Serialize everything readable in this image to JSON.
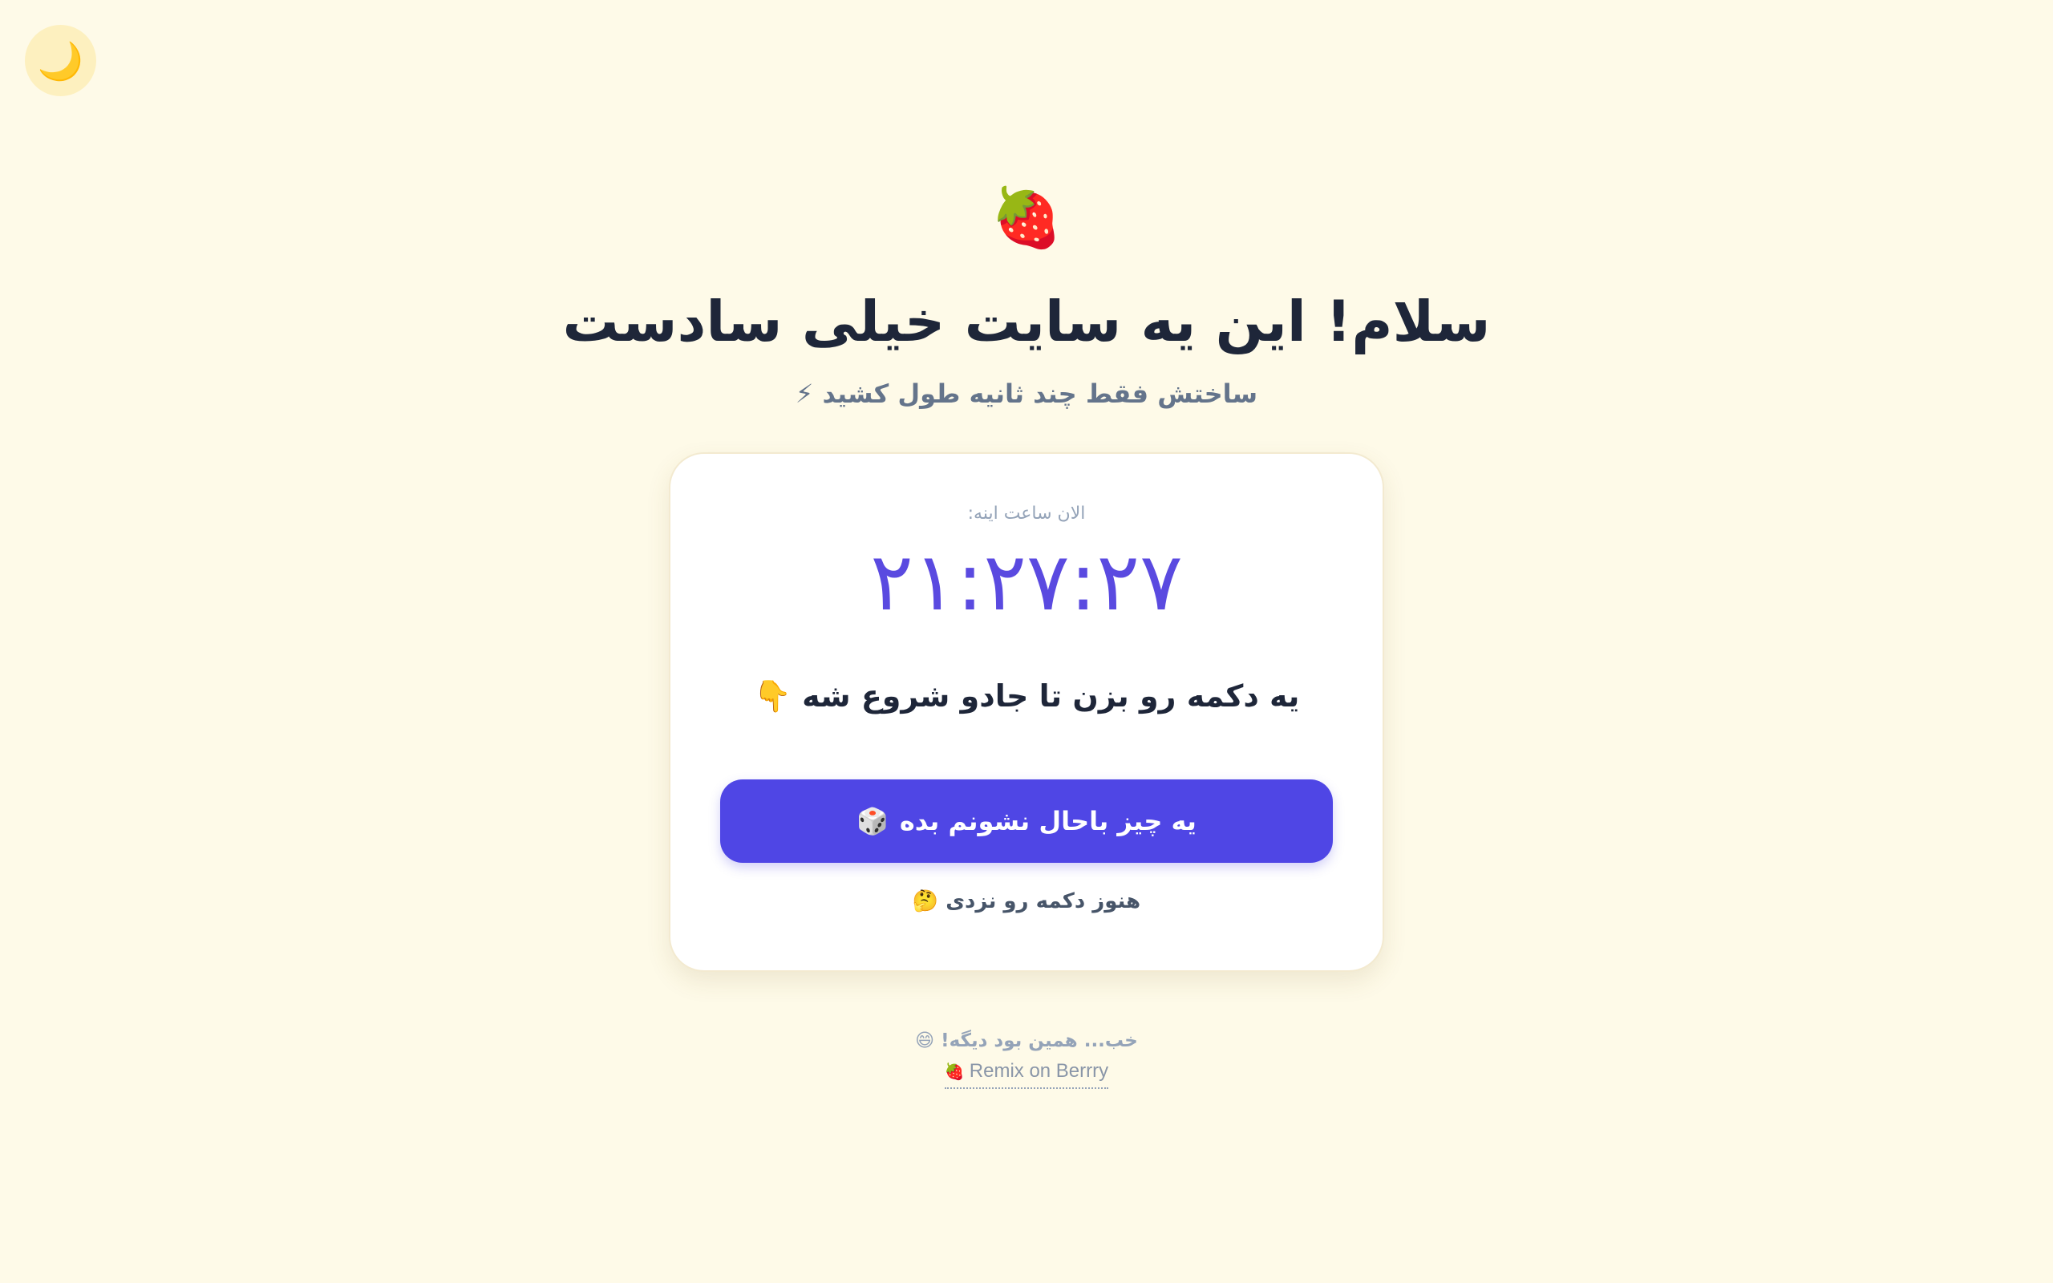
{
  "theme_toggle": {
    "icon": "moon-icon",
    "glyph": "🌙"
  },
  "hero": {
    "icon": "strawberry-icon",
    "glyph": "🍓",
    "title": "سلام! این یه سایت خیلی سادست",
    "subtitle": "ساختش فقط چند ثانیه طول کشید ⚡"
  },
  "card": {
    "clock_label": "الان ساعت اینه:",
    "clock_value": "۲۱:۲۷:۲۷",
    "prompt": "یه دکمه رو بزن تا جادو شروع شه 👇",
    "button_label": "یه چیز باحال نشونم بده",
    "button_icon": "dice-icon",
    "button_glyph": "🎲",
    "status": "هنوز دکمه رو نزدی 🤔"
  },
  "footer": {
    "text": "خب... همین بود دیگه! 😄",
    "link_label": "Remix on Berrry",
    "link_icon": "strawberry-icon",
    "link_glyph": "🍓"
  },
  "colors": {
    "background": "#fefae8",
    "accent": "#4f46e5",
    "title": "#1e2639",
    "muted": "#94a3b8"
  }
}
